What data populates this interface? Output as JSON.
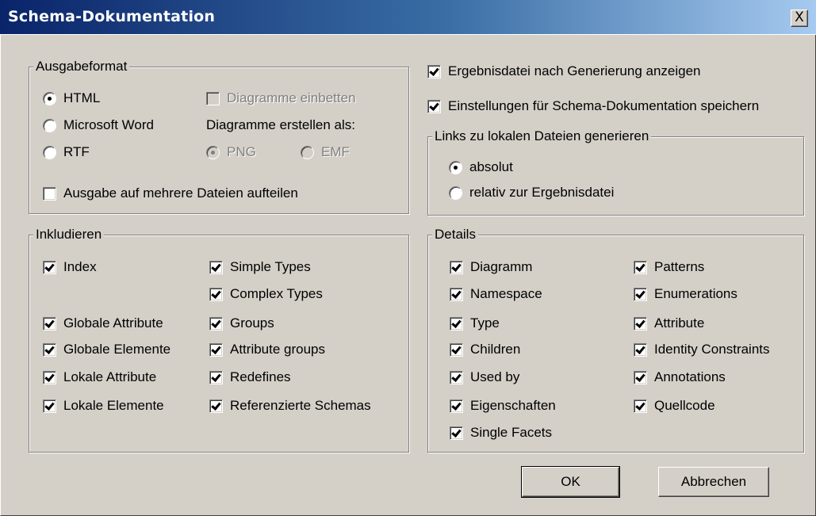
{
  "window": {
    "title": "Schema-Dokumentation",
    "close_label": "X"
  },
  "ausgabeformat": {
    "legend": "Ausgabeformat",
    "html": {
      "label": "HTML",
      "checked": true
    },
    "word": {
      "label": "Microsoft Word",
      "checked": false
    },
    "rtf": {
      "label": "RTF",
      "checked": false
    },
    "diagramme_einbetten": {
      "label": "Diagramme einbetten",
      "checked": false,
      "disabled": true
    },
    "diagramme_als_label": "Diagramme erstellen als:",
    "png": {
      "label": "PNG",
      "checked": true,
      "disabled": true
    },
    "emf": {
      "label": "EMF",
      "checked": false,
      "disabled": true
    },
    "split": {
      "label": "Ausgabe auf mehrere Dateien aufteilen",
      "checked": false
    }
  },
  "options": {
    "show_result": {
      "label": "Ergebnisdatei nach Generierung anzeigen",
      "checked": true
    },
    "save_settings": {
      "label": "Einstellungen für Schema-Dokumentation speichern",
      "checked": true
    }
  },
  "links": {
    "legend": "Links zu lokalen Dateien generieren",
    "absolut": {
      "label": "absolut",
      "checked": true
    },
    "relativ": {
      "label": "relativ zur Ergebnisdatei",
      "checked": false
    }
  },
  "inkludieren": {
    "legend": "Inkludieren",
    "index": "Index",
    "simple_types": "Simple Types",
    "complex_types": "Complex Types",
    "globale_attribute": "Globale Attribute",
    "groups": "Groups",
    "globale_elemente": "Globale Elemente",
    "attribute_groups": "Attribute groups",
    "lokale_attribute": "Lokale Attribute",
    "redefines": "Redefines",
    "lokale_elemente": "Lokale Elemente",
    "referenzierte_schemas": "Referenzierte Schemas"
  },
  "details": {
    "legend": "Details",
    "diagramm": "Diagramm",
    "patterns": "Patterns",
    "namespace": "Namespace",
    "enumerations": "Enumerations",
    "type": "Type",
    "attribute": "Attribute",
    "children": "Children",
    "identity_constraints": "Identity Constraints",
    "used_by": "Used by",
    "annotations": "Annotations",
    "eigenschaften": "Eigenschaften",
    "quellcode": "Quellcode",
    "single_facets": "Single Facets"
  },
  "buttons": {
    "ok": "OK",
    "cancel": "Abbrechen"
  }
}
